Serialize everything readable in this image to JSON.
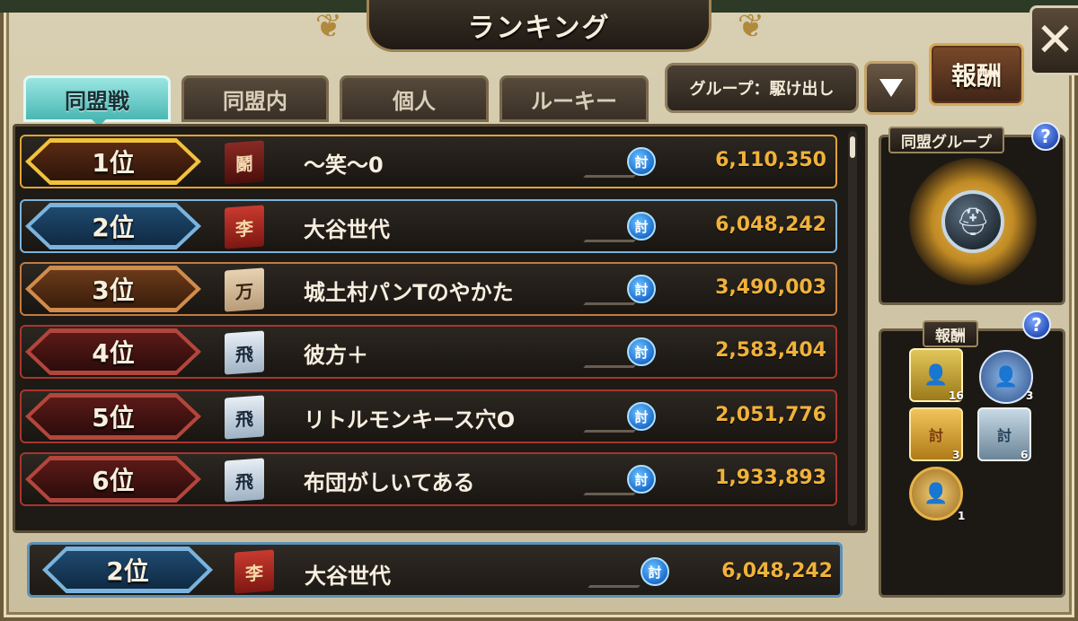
{
  "header": {
    "title": "ランキング",
    "close_label": "✕"
  },
  "tabs": [
    {
      "label": "同盟戦",
      "active": true
    },
    {
      "label": "同盟内",
      "active": false
    },
    {
      "label": "個人",
      "active": false
    },
    {
      "label": "ルーキー",
      "active": false
    }
  ],
  "group_select": {
    "label": "グループ：駆け出し"
  },
  "reward_button": {
    "label": "報酬"
  },
  "rankings": [
    {
      "rank": "1位",
      "flag_char": "鬭",
      "name": "〜笑〜0",
      "score_icon": "討",
      "score": "6,110,350",
      "tier": "gold"
    },
    {
      "rank": "2位",
      "flag_char": "李",
      "name": "大谷世代",
      "score_icon": "討",
      "score": "6,048,242",
      "tier": "silver"
    },
    {
      "rank": "3位",
      "flag_char": "万",
      "name": "城土村パンTのやかた",
      "score_icon": "討",
      "score": "3,490,003",
      "tier": "bronze"
    },
    {
      "rank": "4位",
      "flag_char": "飛",
      "name": "彼方＋",
      "score_icon": "討",
      "score": "2,583,404",
      "tier": "red"
    },
    {
      "rank": "5位",
      "flag_char": "飛",
      "name": "リトルモンキース穴O",
      "score_icon": "討",
      "score": "2,051,776",
      "tier": "red"
    },
    {
      "rank": "6位",
      "flag_char": "飛",
      "name": "布団がしいてある",
      "score_icon": "討",
      "score": "1,933,893",
      "tier": "red"
    }
  ],
  "my_rank": {
    "rank": "2位",
    "flag_char": "李",
    "name": "大谷世代",
    "score_icon": "討",
    "score": "6,048,242"
  },
  "alliance_group_panel": {
    "title": "同盟グループ",
    "help": "?"
  },
  "reward_panel": {
    "title": "報酬",
    "help": "?",
    "items": [
      {
        "icon": "character-card-icon",
        "count": "16"
      },
      {
        "icon": "character-medal-icon",
        "count": "3"
      },
      {
        "icon": "gold-ticket-icon",
        "count": "3"
      },
      {
        "icon": "silver-ticket-icon",
        "count": "6"
      },
      {
        "icon": "character-medal-icon",
        "count": "1"
      }
    ]
  },
  "colors": {
    "gold": "#f2c23a",
    "silver": "#6aa7d6",
    "bronze": "#c98646",
    "red": "#a9352f",
    "score": "#f0b23a",
    "tab_active": "#4bb7b3"
  }
}
